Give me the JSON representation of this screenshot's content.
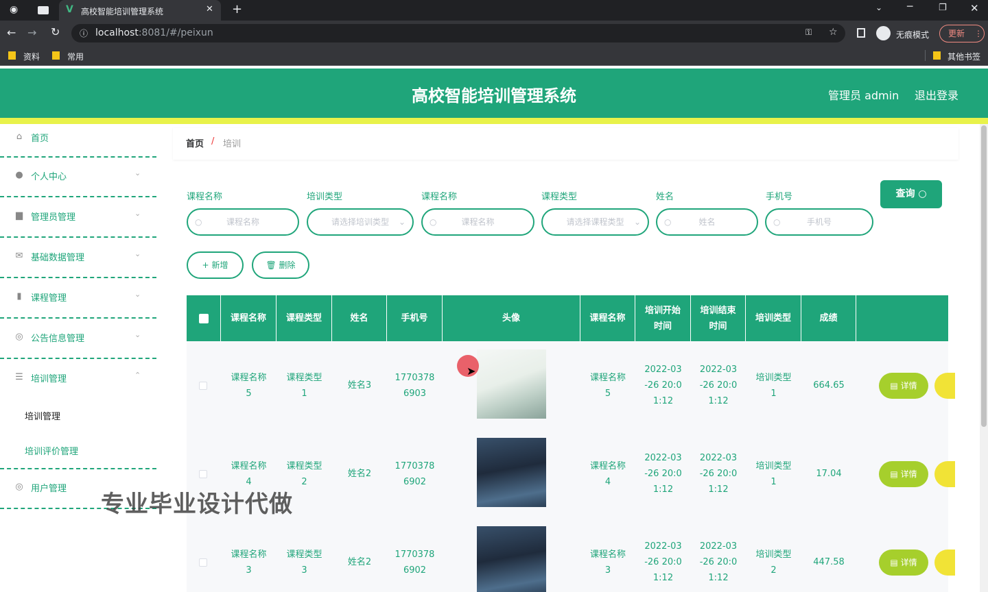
{
  "browser": {
    "tab_title": "高校智能培训管理系统",
    "url_host": "localhost",
    "url_rest": ":8081/#/peixun",
    "incognito_label": "无痕模式",
    "update_label": "更新",
    "bookmarks": [
      "资料",
      "常用"
    ],
    "other_bookmarks": "其他书签"
  },
  "header": {
    "title": "高校智能培训管理系统",
    "user": "管理员 admin",
    "logout": "退出登录"
  },
  "sidebar": {
    "items": [
      {
        "label": "首页",
        "icon": "home-icon"
      },
      {
        "label": "个人中心",
        "icon": "user-icon"
      },
      {
        "label": "管理员管理",
        "icon": "book-icon"
      },
      {
        "label": "基础数据管理",
        "icon": "mail-icon"
      },
      {
        "label": "课程管理",
        "icon": "bar-chart-icon"
      },
      {
        "label": "公告信息管理",
        "icon": "compass-icon"
      },
      {
        "label": "培训管理",
        "icon": "list-icon"
      },
      {
        "label": "用户管理",
        "icon": "settings-icon"
      }
    ],
    "subitems": [
      "培训管理",
      "培训评价管理"
    ]
  },
  "breadcrumb": {
    "home": "首页",
    "sep": "/",
    "current": "培训"
  },
  "search": {
    "labels": [
      "课程名称",
      "培训类型",
      "课程名称",
      "课程类型",
      "姓名",
      "手机号"
    ],
    "placeholders": [
      "课程名称",
      "请选择培训类型",
      "课程名称",
      "请选择课程类型",
      "姓名",
      "手机号"
    ],
    "query_button": "查询"
  },
  "actions": {
    "add": "新增",
    "delete": "删除"
  },
  "table": {
    "headers": [
      "课程名称",
      "课程类型",
      "姓名",
      "手机号",
      "头像",
      "课程名称",
      "培训开始\n时间",
      "培训结束\n时间",
      "培训类型",
      "成绩"
    ],
    "rows": [
      {
        "course": "课程名称\n5",
        "ctype": "课程类型\n1",
        "name": "姓名3",
        "phone": "1770378\n6903",
        "course2": "课程名称\n5",
        "start": "2022-03\n-26 20:0\n1:12",
        "end": "2022-03\n-26 20:0\n1:12",
        "ttype": "培训类型\n1",
        "score": "664.65"
      },
      {
        "course": "课程名称\n4",
        "ctype": "课程类型\n2",
        "name": "姓名2",
        "phone": "1770378\n6902",
        "course2": "课程名称\n4",
        "start": "2022-03\n-26 20:0\n1:12",
        "end": "2022-03\n-26 20:0\n1:12",
        "ttype": "培训类型\n1",
        "score": "17.04"
      },
      {
        "course": "课程名称\n3",
        "ctype": "课程类型\n3",
        "name": "姓名2",
        "phone": "1770378\n6902",
        "course2": "课程名称\n3",
        "start": "2022-03\n-26 20:0\n1:12",
        "end": "2022-03\n-26 20:0\n1:12",
        "ttype": "培训类型\n2",
        "score": "447.58"
      }
    ],
    "detail_label": "详情"
  },
  "watermark": "专业毕业设计代做",
  "colors": {
    "primary": "#1fa57a",
    "accent_bar": "#e8f24a",
    "detail": "#a6cf2c"
  }
}
